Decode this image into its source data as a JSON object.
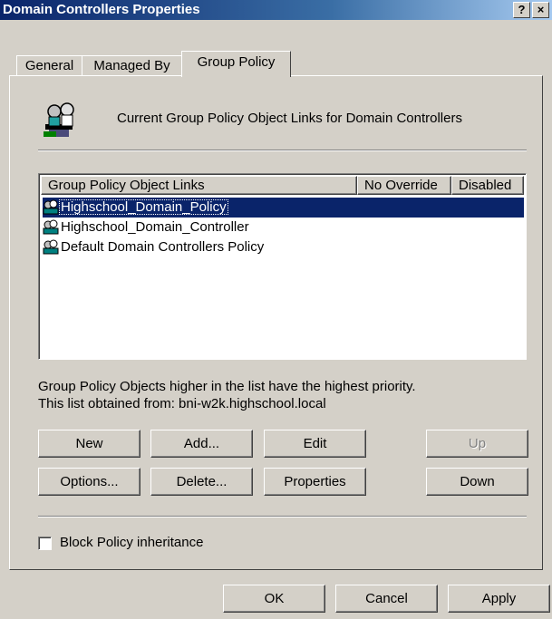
{
  "window": {
    "title": "Domain Controllers Properties",
    "help_label": "?",
    "close_label": "×"
  },
  "tabs": [
    {
      "label": "General"
    },
    {
      "label": "Managed By"
    },
    {
      "label": "Group Policy"
    }
  ],
  "header": {
    "text": "Current Group Policy Object Links for Domain Controllers"
  },
  "list": {
    "columns": [
      "Group Policy Object Links",
      "No Override",
      "Disabled"
    ],
    "items": [
      {
        "label": "Highschool_Domain_Policy",
        "selected": true
      },
      {
        "label": "Highschool_Domain_Controller",
        "selected": false
      },
      {
        "label": "Default Domain Controllers Policy",
        "selected": false
      }
    ]
  },
  "info": {
    "line1": "Group Policy Objects higher in the list have the highest priority.",
    "line2": "This list obtained from: bni-w2k.highschool.local"
  },
  "buttons": {
    "new": "New",
    "add": "Add...",
    "edit": "Edit",
    "up": "Up",
    "options": "Options...",
    "delete": "Delete...",
    "properties": "Properties",
    "down": "Down"
  },
  "checkbox": {
    "label": "Block Policy inheritance",
    "checked": false
  },
  "footer": {
    "ok": "OK",
    "cancel": "Cancel",
    "apply": "Apply"
  }
}
